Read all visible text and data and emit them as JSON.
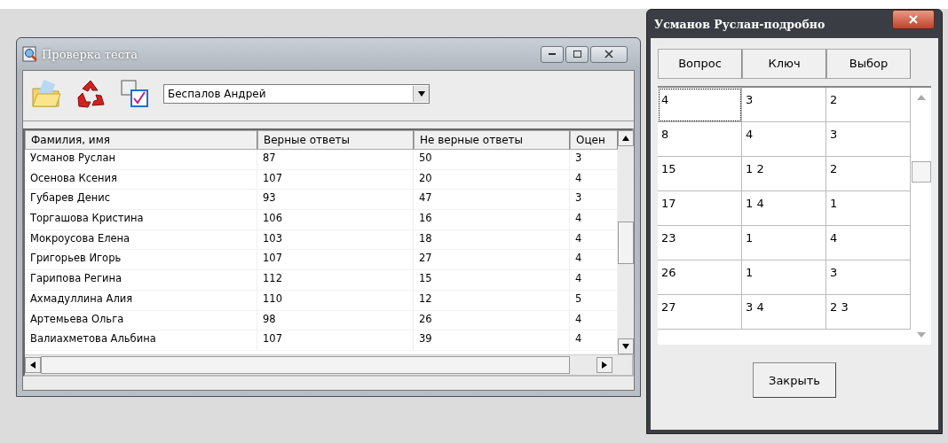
{
  "main_window": {
    "title": "Проверка теста",
    "student_select": {
      "value": "Беспалов Андрей"
    },
    "table": {
      "columns": [
        "Фамилия, имя",
        "Верные ответы",
        "Не верные ответы",
        "Оцен"
      ],
      "rows": [
        [
          "Усманов Руслан",
          "87",
          "50",
          "3"
        ],
        [
          "Осенова Ксения",
          "107",
          "20",
          "4"
        ],
        [
          "Губарев Денис",
          "93",
          "47",
          "3"
        ],
        [
          "Торгашова Кристина",
          "106",
          "16",
          "4"
        ],
        [
          "Мокроусова Елена",
          "103",
          "18",
          "4"
        ],
        [
          "Григорьев Игорь",
          "107",
          "27",
          "4"
        ],
        [
          "Гарипова Регина",
          "112",
          "15",
          "4"
        ],
        [
          "Ахмадуллина Алия",
          "110",
          "12",
          "5"
        ],
        [
          "Артемьева Ольга",
          "98",
          "26",
          "4"
        ],
        [
          "Валиахметова Альбина",
          "107",
          "39",
          "4"
        ]
      ]
    }
  },
  "detail_window": {
    "title": "Усманов Руслан-подробно",
    "table": {
      "columns": [
        "Вопрос",
        "Ключ",
        "Выбор"
      ],
      "rows": [
        {
          "cells": [
            "4",
            "3",
            "2"
          ],
          "selected": true
        },
        {
          "cells": [
            "8",
            "4",
            "3"
          ],
          "selected": false
        },
        {
          "cells": [
            "15",
            "1 2",
            "2"
          ],
          "selected": false
        },
        {
          "cells": [
            "17",
            "1 4",
            "1"
          ],
          "selected": false
        },
        {
          "cells": [
            "23",
            "1",
            "4"
          ],
          "selected": false
        },
        {
          "cells": [
            "26",
            "1",
            "3"
          ],
          "selected": false
        },
        {
          "cells": [
            "27",
            "3 4",
            "2 3"
          ],
          "selected": false
        }
      ]
    },
    "close_button": "Закрыть"
  }
}
